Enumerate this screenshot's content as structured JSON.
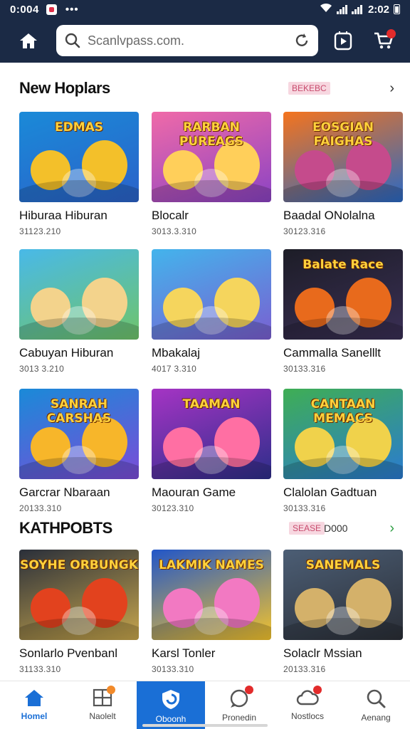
{
  "status_bar": {
    "time": "0:004",
    "right_time": "2:02",
    "dots": "•••",
    "wifi_icon": "wifi-icon",
    "battery_icon": "battery-icon"
  },
  "top_bar": {
    "search_placeholder": "Scanlvpass.com.",
    "home_icon": "home-icon",
    "play_icon": "play-store-icon",
    "cart_icon": "cart-icon"
  },
  "sections": [
    {
      "title": "New Hoplars",
      "badge": "BEKEBC",
      "chevron": "›",
      "items": [
        {
          "title": "Hiburaa Hiburan",
          "meta": "31123.210",
          "thumb_text": "EDMAS",
          "colors": [
            "#1a8ad8",
            "#f3c02a",
            "#2b62c9"
          ]
        },
        {
          "title": "Blocalr",
          "meta": "3013.3.310",
          "thumb_text": "RARBAN PUREAGS",
          "colors": [
            "#f06aa8",
            "#ffcf5a",
            "#8b43c4"
          ]
        },
        {
          "title": "Baadal ONolalna",
          "meta": "30123.316",
          "thumb_text": "EOSGIAN FAIGHAS",
          "colors": [
            "#f5741d",
            "#c54b8c",
            "#2a69c4"
          ]
        }
      ]
    },
    {
      "title": "",
      "badge": "",
      "chevron": "",
      "items": [
        {
          "title": "Cabuyan Hiburan",
          "meta": "3013 3.210",
          "thumb_text": "",
          "colors": [
            "#49b9e8",
            "#f3d38c",
            "#6fc46a"
          ]
        },
        {
          "title": "Mbakalaj",
          "meta": "4017 3.310",
          "thumb_text": "",
          "colors": [
            "#43b4ec",
            "#f5d55d",
            "#7a5fd1"
          ]
        },
        {
          "title": "Cammalla Sanelllt",
          "meta": "30133.316",
          "thumb_text": "Balate Race",
          "colors": [
            "#1d1d27",
            "#e86a1c",
            "#3a2f55"
          ]
        }
      ]
    },
    {
      "title": "",
      "badge": "",
      "chevron": "",
      "items": [
        {
          "title": "Garcrar Nbaraan",
          "meta": "20133.310",
          "thumb_text": "SANRAH CARSHAS",
          "colors": [
            "#1a8ad8",
            "#f7b62a",
            "#7b4cd8"
          ]
        },
        {
          "title": "Maouran Game",
          "meta": "30123.310",
          "thumb_text": "TAAMAN",
          "colors": [
            "#a534c4",
            "#ff6fa3",
            "#2d2e8a"
          ]
        },
        {
          "title": "Clalolan Gadtuan",
          "meta": "30133.316",
          "thumb_text": "CANTAAN MEMACS",
          "colors": [
            "#3fae54",
            "#f0d24b",
            "#2a7bd1"
          ]
        }
      ]
    },
    {
      "title": "KATHPOBTS",
      "badge": "SEASE",
      "badge_extra": "D000",
      "chevron": "›",
      "items": [
        {
          "title": "Sonlarlo Pvenbanl",
          "meta": "31133.310",
          "thumb_text": "SOYHE ORBUNGK",
          "colors": [
            "#2a2f3a",
            "#e2421e",
            "#c7a64c"
          ]
        },
        {
          "title": "Karsl Tonler",
          "meta": "30133.310",
          "thumb_text": "LAKMIK NAMES",
          "colors": [
            "#2156c9",
            "#f279c2",
            "#f3c32c"
          ]
        },
        {
          "title": "Solaclr Mssian",
          "meta": "20133.316",
          "thumb_text": "SANEMALS",
          "colors": [
            "#4c5e75",
            "#d4b16a",
            "#2a2e36"
          ]
        }
      ]
    }
  ],
  "bottom_nav": [
    {
      "label": "Homel",
      "icon": "home-icon"
    },
    {
      "label": "Naolelt",
      "icon": "grid-icon"
    },
    {
      "label": "Oboonh",
      "icon": "shield-icon"
    },
    {
      "label": "Pronedin",
      "icon": "chat-icon"
    },
    {
      "label": "Nostlocs",
      "icon": "cloud-icon"
    },
    {
      "label": "Aenang",
      "icon": "search-icon"
    }
  ],
  "colors": {
    "header_bg": "#1b2a45",
    "accent": "#1a6fd6",
    "badge_red": "#e22b2b"
  }
}
